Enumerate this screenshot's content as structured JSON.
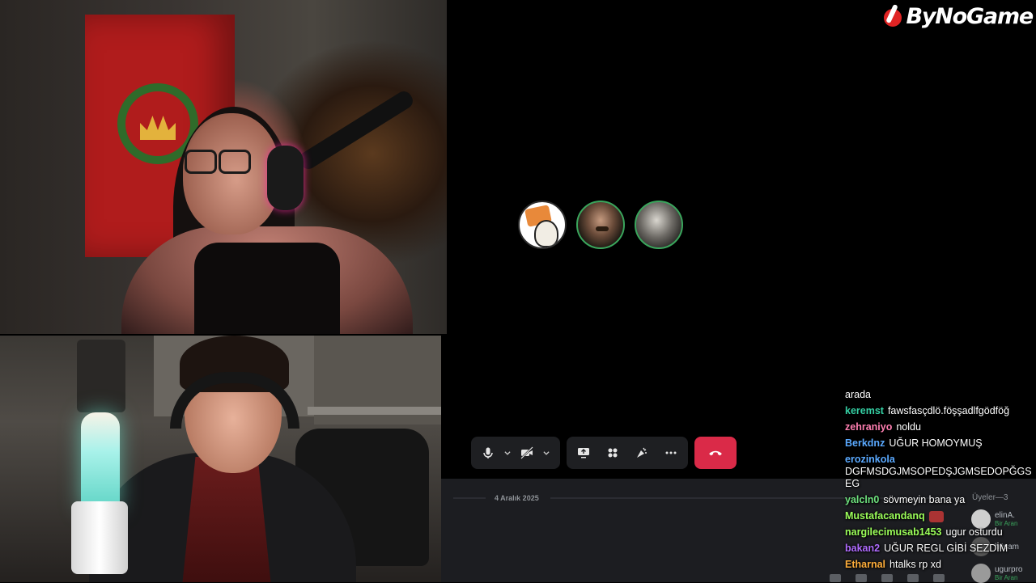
{
  "brand": {
    "logo_text": "ByNoGame"
  },
  "call": {
    "participants": [
      {
        "avatar": "cartoon-avatar"
      },
      {
        "avatar": "man-portrait-avatar"
      },
      {
        "avatar": "man-bw-portrait-avatar"
      }
    ],
    "controls": {
      "mic_icon": "microphone-icon",
      "camera_icon": "camera-off-icon",
      "screen_share_icon": "screen-share-icon",
      "activities_icon": "activities-icon",
      "soundboard_icon": "soundboard-icon",
      "more_icon": "more-icon",
      "hangup_icon": "phone-hangup-icon"
    },
    "hangup_color": "#da2a48"
  },
  "channel": {
    "date_divider": "4 Aralık 2025",
    "members_label": "Üyeler—3",
    "members": [
      {
        "name": "elinA.",
        "status": "Bir Aran"
      },
      {
        "name": "hüsam",
        "status": ""
      },
      {
        "name": "ugurpro",
        "status": "Bir Aran"
      }
    ]
  },
  "chat": {
    "messages": [
      {
        "user": "",
        "color": "#ffffff",
        "text": "arada"
      },
      {
        "user": "keremst",
        "color": "#35d0a4",
        "text": "fawsfasçdlö.föşşadlfgödföğ"
      },
      {
        "user": "zehraniyo",
        "color": "#ff7fb1",
        "text": "noldu"
      },
      {
        "user": "Berkdnz",
        "color": "#5aa9ff",
        "text": "UĞUR HOMOYMUŞ"
      },
      {
        "user": "erozinkola",
        "color": "#5aa9ff",
        "text": "DGFMSDGJMSOPEDŞJGMSEDOPĞGSEG"
      },
      {
        "user": "yalcln0",
        "color": "#6ee17e",
        "text": "sövmeyin bana ya"
      },
      {
        "user": "Mustafacandanq",
        "color": "#9cff5a",
        "text": ""
      },
      {
        "user": "nargilecimusab1453",
        "color": "#9cff5a",
        "text": "ugur osturdu"
      },
      {
        "user": "bakan2",
        "color": "#b06cff",
        "text": "UĞUR REGL GİBİ SEZDİM"
      },
      {
        "user": "Etharnal",
        "color": "#ffae3b",
        "text": "htalks rp xd"
      }
    ]
  }
}
